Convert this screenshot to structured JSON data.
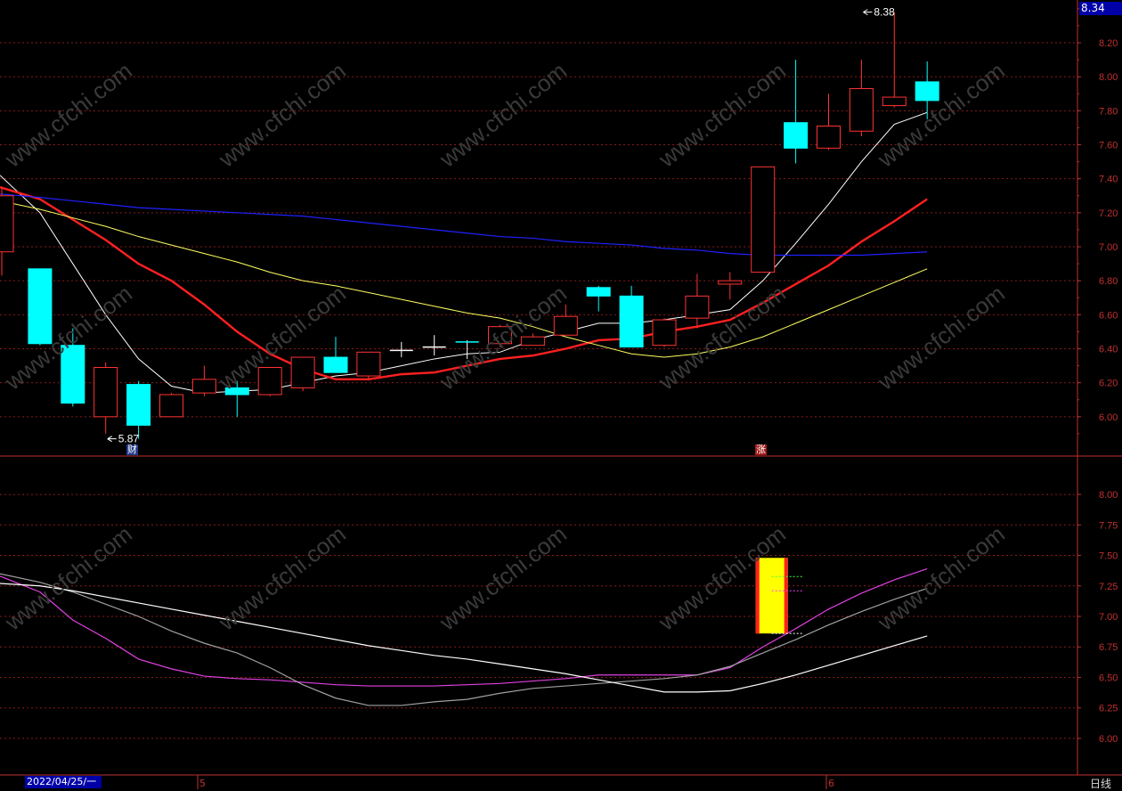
{
  "current_price_label": "8.34",
  "bottom_bar": {
    "date": "2022/04/25/一",
    "period": "日线",
    "months": [
      "5",
      "6"
    ]
  },
  "watermark": "www.cfchi.com",
  "markers": {
    "fin": "财",
    "limit": "涨"
  },
  "colors": {
    "up": "#ff3232",
    "down": "#00ffff",
    "ma5": "#ffffff",
    "ma10": "#ff2020",
    "ma20": "#ffff60",
    "ma60": "#2020ff",
    "grid": "#8b1a1a",
    "axis": "#c03030"
  },
  "chart_data": [
    {
      "type": "candlestick",
      "y_ticks": [
        "6.00",
        "6.20",
        "6.40",
        "6.60",
        "6.80",
        "7.00",
        "7.20",
        "7.40",
        "7.60",
        "7.80",
        "8.00",
        "8.20"
      ],
      "ylim": [
        5.8,
        8.42
      ],
      "annotations": [
        {
          "text": "8.38",
          "value": 8.38,
          "index": 26
        },
        {
          "text": "5.87",
          "value": 5.87,
          "index": 3
        }
      ],
      "candles": [
        {
          "o": 6.97,
          "h": 7.35,
          "l": 6.83,
          "c": 7.3
        },
        {
          "o": 6.87,
          "h": 6.87,
          "l": 6.42,
          "c": 6.43
        },
        {
          "o": 6.42,
          "h": 6.52,
          "l": 6.06,
          "c": 6.08
        },
        {
          "o": 6.0,
          "h": 6.32,
          "l": 5.9,
          "c": 6.29
        },
        {
          "o": 6.19,
          "h": 6.21,
          "l": 5.87,
          "c": 5.95
        },
        {
          "o": 6.0,
          "h": 6.14,
          "l": 6.0,
          "c": 6.13
        },
        {
          "o": 6.14,
          "h": 6.3,
          "l": 6.12,
          "c": 6.22
        },
        {
          "o": 6.17,
          "h": 6.21,
          "l": 6.0,
          "c": 6.13
        },
        {
          "o": 6.13,
          "h": 6.29,
          "l": 6.12,
          "c": 6.29
        },
        {
          "o": 6.17,
          "h": 6.35,
          "l": 6.15,
          "c": 6.35
        },
        {
          "o": 6.35,
          "h": 6.47,
          "l": 6.26,
          "c": 6.26
        },
        {
          "o": 6.24,
          "h": 6.38,
          "l": 6.22,
          "c": 6.38
        },
        {
          "o": 6.39,
          "h": 6.44,
          "l": 6.35,
          "c": 6.39
        },
        {
          "o": 6.41,
          "h": 6.48,
          "l": 6.36,
          "c": 6.41
        },
        {
          "o": 6.44,
          "h": 6.45,
          "l": 6.34,
          "c": 6.44
        },
        {
          "o": 6.43,
          "h": 6.54,
          "l": 6.41,
          "c": 6.53
        },
        {
          "o": 6.42,
          "h": 6.49,
          "l": 6.42,
          "c": 6.47
        },
        {
          "o": 6.48,
          "h": 6.66,
          "l": 6.48,
          "c": 6.59
        },
        {
          "o": 6.76,
          "h": 6.77,
          "l": 6.62,
          "c": 6.71
        },
        {
          "o": 6.71,
          "h": 6.77,
          "l": 6.41,
          "c": 6.41
        },
        {
          "o": 6.42,
          "h": 6.58,
          "l": 6.41,
          "c": 6.57
        },
        {
          "o": 6.58,
          "h": 6.84,
          "l": 6.52,
          "c": 6.71
        },
        {
          "o": 6.78,
          "h": 6.85,
          "l": 6.69,
          "c": 6.8
        },
        {
          "o": 6.85,
          "h": 7.47,
          "l": 6.85,
          "c": 7.47
        },
        {
          "o": 7.73,
          "h": 8.1,
          "l": 7.49,
          "c": 7.58
        },
        {
          "o": 7.58,
          "h": 7.9,
          "l": 7.57,
          "c": 7.71
        },
        {
          "o": 7.68,
          "h": 8.1,
          "l": 7.65,
          "c": 7.93
        },
        {
          "o": 7.83,
          "h": 8.38,
          "l": 7.82,
          "c": 7.88
        },
        {
          "o": 7.97,
          "h": 8.09,
          "l": 7.75,
          "c": 7.86
        }
      ],
      "series": [
        {
          "key": "ma5",
          "values": [
            7.42,
            7.2,
            6.9,
            6.6,
            6.34,
            6.18,
            6.14,
            6.15,
            6.16,
            6.2,
            6.24,
            6.26,
            6.3,
            6.34,
            6.37,
            6.38,
            6.45,
            6.5,
            6.55,
            6.55,
            6.57,
            6.6,
            6.63,
            6.8,
            7.02,
            7.25,
            7.5,
            7.72,
            7.79
          ]
        },
        {
          "key": "ma10",
          "values": [
            7.35,
            7.28,
            7.16,
            7.04,
            6.9,
            6.8,
            6.66,
            6.5,
            6.37,
            6.28,
            6.22,
            6.22,
            6.25,
            6.26,
            6.3,
            6.34,
            6.36,
            6.4,
            6.45,
            6.46,
            6.5,
            6.53,
            6.57,
            6.67,
            6.78,
            6.89,
            7.03,
            7.15,
            7.28
          ]
        },
        {
          "key": "ma20",
          "values": [
            7.27,
            7.22,
            7.17,
            7.12,
            7.06,
            7.01,
            6.96,
            6.91,
            6.85,
            6.8,
            6.77,
            6.73,
            6.69,
            6.65,
            6.61,
            6.58,
            6.53,
            6.47,
            6.42,
            6.37,
            6.35,
            6.37,
            6.41,
            6.47,
            6.55,
            6.63,
            6.71,
            6.79,
            6.87
          ]
        },
        {
          "key": "ma60",
          "values": [
            7.31,
            7.29,
            7.27,
            7.25,
            7.23,
            7.22,
            7.21,
            7.2,
            7.19,
            7.18,
            7.16,
            7.14,
            7.12,
            7.1,
            7.08,
            7.06,
            7.05,
            7.03,
            7.02,
            7.01,
            6.99,
            6.98,
            6.96,
            6.95,
            6.95,
            6.95,
            6.95,
            6.96,
            6.97
          ]
        }
      ]
    },
    {
      "type": "line",
      "y_ticks": [
        "6.00",
        "6.25",
        "6.50",
        "6.75",
        "7.00",
        "7.25",
        "7.50",
        "7.75",
        "8.00"
      ],
      "ylim": [
        5.7,
        8.3
      ],
      "series": [
        {
          "key": "magenta",
          "values": [
            7.33,
            7.2,
            6.97,
            6.82,
            6.65,
            6.57,
            6.51,
            6.49,
            6.48,
            6.46,
            6.44,
            6.43,
            6.43,
            6.43,
            6.44,
            6.45,
            6.47,
            6.49,
            6.52,
            6.52,
            6.52,
            6.52,
            6.58,
            6.75,
            6.9,
            7.06,
            7.19,
            7.3,
            7.39
          ]
        },
        {
          "key": "gray",
          "values": [
            7.35,
            7.28,
            7.2,
            7.1,
            7.0,
            6.88,
            6.78,
            6.7,
            6.58,
            6.44,
            6.33,
            6.27,
            6.27,
            6.3,
            6.32,
            6.37,
            6.41,
            6.43,
            6.45,
            6.47,
            6.49,
            6.52,
            6.59,
            6.7,
            6.81,
            6.93,
            7.04,
            7.14,
            7.23
          ]
        },
        {
          "key": "white",
          "values": [
            7.27,
            7.25,
            7.21,
            7.16,
            7.11,
            7.06,
            7.01,
            6.96,
            6.91,
            6.86,
            6.81,
            6.76,
            6.72,
            6.68,
            6.65,
            6.61,
            6.57,
            6.53,
            6.48,
            6.43,
            6.38,
            6.38,
            6.39,
            6.45,
            6.52,
            6.6,
            6.68,
            6.76,
            6.84
          ]
        }
      ],
      "signal": {
        "index": 23,
        "low": 6.86,
        "high": 7.48
      }
    }
  ]
}
